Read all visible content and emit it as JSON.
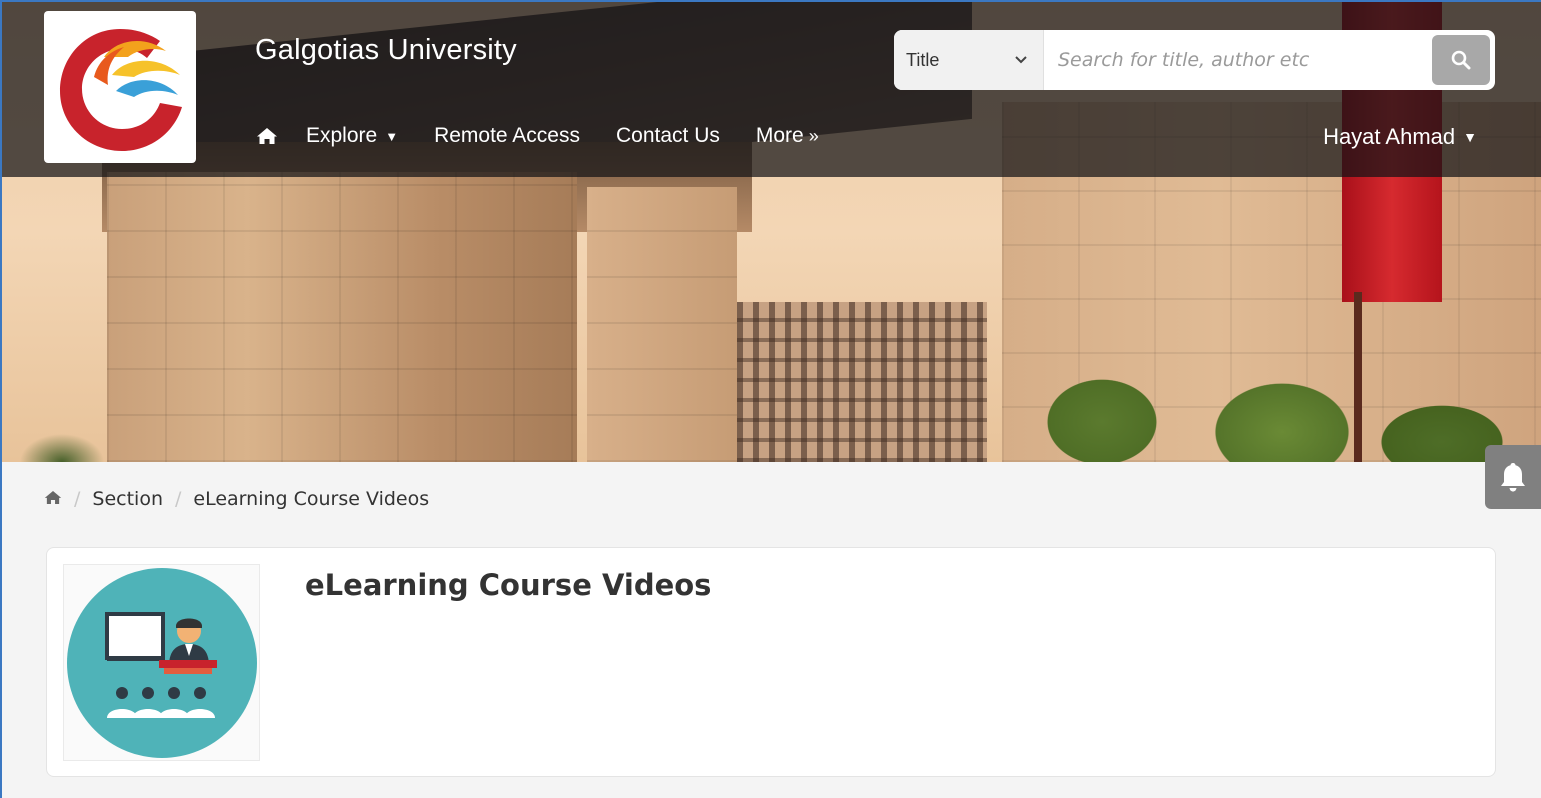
{
  "header": {
    "site_title": "Galgotias University",
    "search": {
      "field_selected": "Title",
      "placeholder": "Search for title, author etc"
    },
    "nav": {
      "explore": "Explore",
      "remote_access": "Remote Access",
      "contact_us": "Contact Us",
      "more": "More"
    },
    "user_name": "Hayat Ahmad"
  },
  "breadcrumb": {
    "section": "Section",
    "current": "eLearning Course Videos"
  },
  "card": {
    "title": "eLearning Course Videos"
  },
  "icons": {
    "home": "home-icon",
    "search": "search-icon",
    "bell": "bell-icon"
  },
  "colors": {
    "thumb_circle": "#4fb3b8",
    "accent_red": "#c8232c"
  }
}
